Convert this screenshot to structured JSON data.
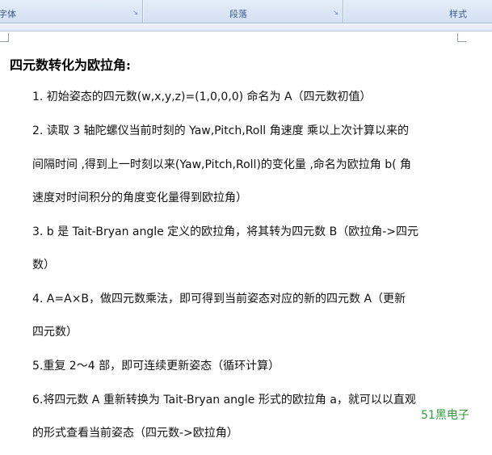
{
  "ribbon": {
    "groups": [
      {
        "label": "字体",
        "launcher_icon": "dialog-launcher-icon"
      },
      {
        "label": "段落",
        "launcher_icon": "dialog-launcher-icon"
      },
      {
        "label": "样式"
      }
    ]
  },
  "document": {
    "heading": "四元数转化为欧拉角:",
    "lines": [
      "1. 初始姿态的四元数(w,x,y,z)=(1,0,0,0)  命名为 A（四元数初值）",
      "2. 读取 3 轴陀螺仪当前时刻的 Yaw,Pitch,Roll 角速度  乘以上次计算以来的",
      "间隔时间 ,得到上一时刻以来(Yaw,Pitch,Roll)的变化量 ,命名为欧拉角 b( 角",
      "速度对时间积分的角度变化量得到欧拉角）",
      "3. b 是 Tait-Bryan angle 定义的欧拉角，将其转为四元数 B（欧拉角->四元",
      "数）",
      "4. A=A×B，做四元数乘法，即可得到当前姿态对应的新的四元数 A（更新",
      "四元数）",
      "5.重复 2～4 部，即可连续更新姿态（循环计算）",
      "6.将四元数 A 重新转换为 Tait-Bryan angle 形式的欧拉角 a，就可以以直观",
      "的形式查看当前姿态（四元数->欧拉角）"
    ]
  },
  "watermark": "51黑电子"
}
